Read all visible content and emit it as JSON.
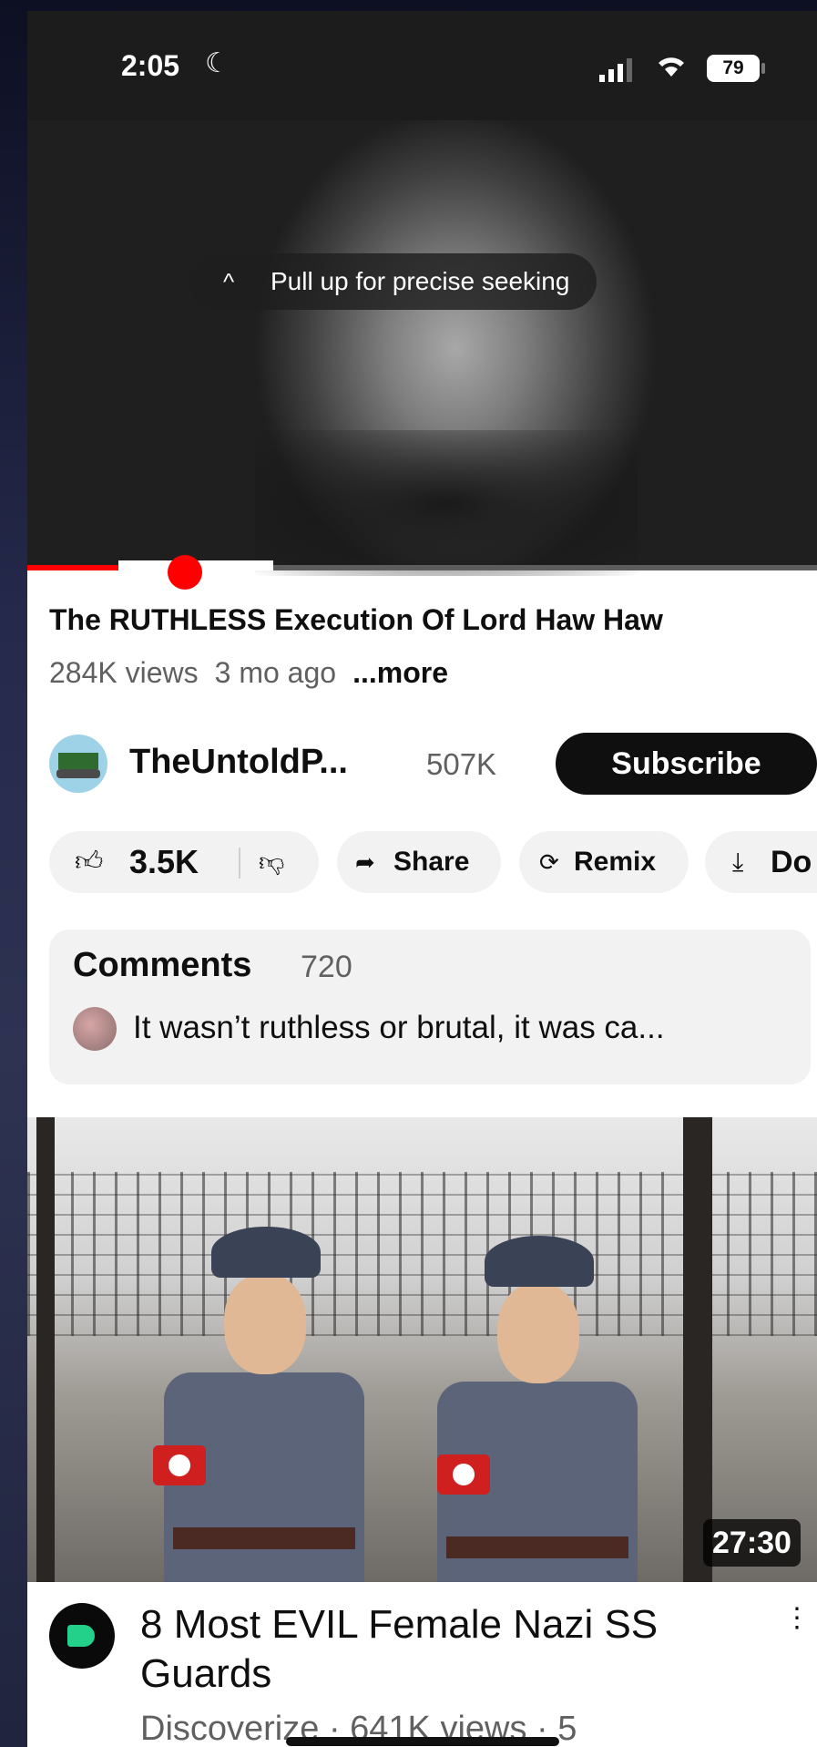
{
  "status_bar": {
    "time": "2:05",
    "battery": "79"
  },
  "player": {
    "seek_hint": "Pull up for precise seeking",
    "progress_fraction": 0.2
  },
  "video": {
    "title": "The RUTHLESS Execution Of Lord Haw Haw",
    "views": "284K views",
    "age": "3 mo ago",
    "more_label": "...more"
  },
  "channel": {
    "name": "TheUntoldP...",
    "subscribers": "507K",
    "subscribe_label": "Subscribe"
  },
  "actions": {
    "like_count": "3.5K",
    "share_label": "Share",
    "remix_label": "Remix",
    "download_label": "Do"
  },
  "comments": {
    "title": "Comments",
    "count": "720",
    "top_comment": "It wasn’t ruthless or brutal, it was ca..."
  },
  "recommended": {
    "duration": "27:30",
    "title": "8 Most EVIL Female Nazi SS Guards",
    "meta": "Discoverize · 641K views · 5"
  },
  "colors": {
    "accent": "#ff0000",
    "subscribe_bg": "#0f0f0f",
    "pill_bg": "#f2f2f2"
  },
  "icons": [
    "moon-icon",
    "signal-icon",
    "wifi-icon",
    "battery-icon",
    "chevron-up-icon",
    "thumbs-up-icon",
    "thumbs-down-icon",
    "share-icon",
    "remix-icon",
    "download-icon",
    "more-vert-icon"
  ]
}
